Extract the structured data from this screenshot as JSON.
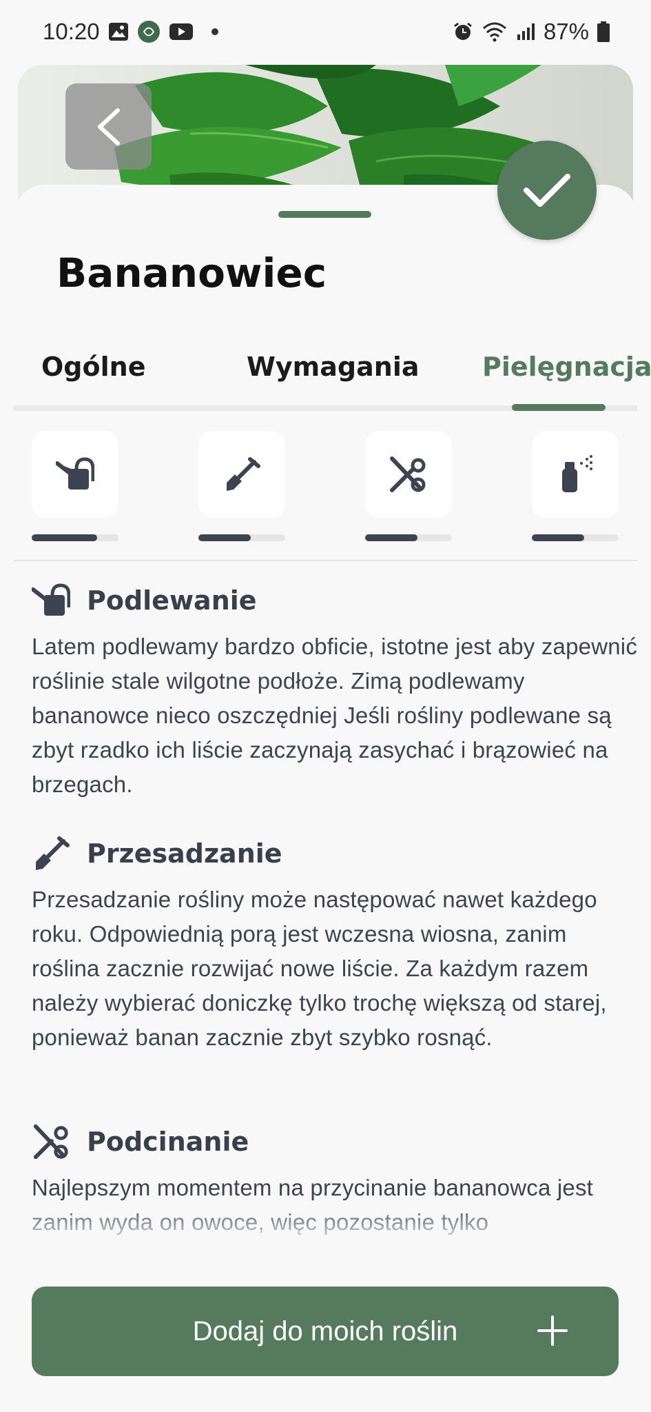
{
  "status_bar": {
    "time": "10:20",
    "battery": "87%",
    "icons_left": [
      "gallery-icon",
      "app-icon",
      "youtube-icon",
      "dot"
    ],
    "icons_right": [
      "alarm-icon",
      "wifi-icon",
      "signal-icon",
      "battery-icon"
    ]
  },
  "header": {
    "back_icon": "chevron-left-icon",
    "confirm_icon": "check-icon"
  },
  "plant": {
    "name": "Bananowiec"
  },
  "tabs": [
    {
      "label": "Ogólne"
    },
    {
      "label": "Wymagania"
    },
    {
      "label": "Pielęgnacja",
      "active": true
    }
  ],
  "care_cards": [
    {
      "icon": "watering-can-icon",
      "level": 0.75
    },
    {
      "icon": "shovel-icon",
      "level": 0.6
    },
    {
      "icon": "scissors-icon",
      "level": 0.6
    },
    {
      "icon": "spray-bottle-icon",
      "level": 0.6
    }
  ],
  "sections": [
    {
      "icon": "watering-can-icon",
      "title": "Podlewanie",
      "text": "Latem podlewamy bardzo obficie, istotne jest aby zapewnić roślinie stale wilgotne podłoże. Zimą podlewamy bananowce nieco oszczędniej Jeśli rośliny podlewane są zbyt rzadko ich liście zaczynają zasychać i brązowieć na brzegach."
    },
    {
      "icon": "shovel-icon",
      "title": "Przesadzanie",
      "text": "Przesadzanie rośliny może następować nawet każdego roku. Odpowiednią porą jest wczesna wiosna, zanim roślina zacznie rozwijać nowe liście. Za każdym razem należy wybierać doniczkę tylko trochę większą od starej, ponieważ banan zacznie zbyt szybko rosnąć."
    },
    {
      "icon": "scissors-icon",
      "title": "Podcinanie",
      "text": "Najlepszym momentem na przycinanie bananowca jest zanim wyda on owoce, więc pozostanie tylko"
    }
  ],
  "add_button": {
    "label": "Dodaj do moich roślin",
    "icon": "plus-icon"
  },
  "colors": {
    "accent": "#567a5e",
    "text": "#3e4350",
    "background": "#f8f8f8"
  }
}
